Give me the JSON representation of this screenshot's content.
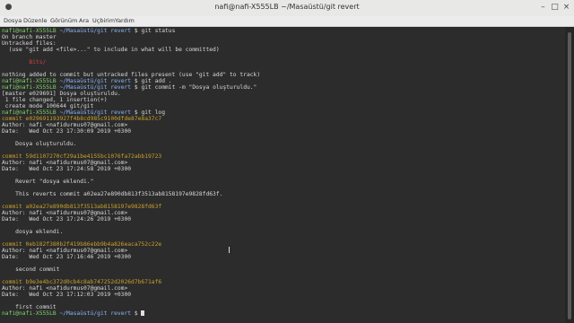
{
  "window": {
    "title": "nafi@nafi-X555LB ~/Masaüstü/git revert"
  },
  "menu": [
    "Dosya",
    "Düzenle",
    "Görünüm",
    "Ara",
    "Uçbirim",
    "Yardım"
  ],
  "prompt": {
    "user": "nafi@nafi-X555LB",
    "path": "~/Masaüstü/git revert",
    "symbol": "$"
  },
  "lines": [
    {
      "t": "prompt",
      "cmd": "git status"
    },
    {
      "t": "text",
      "s": "On branch master"
    },
    {
      "t": "text",
      "s": "Untracked files:"
    },
    {
      "t": "text",
      "s": "  (use \"git add <file>...\" to include in what will be committed)"
    },
    {
      "t": "blank"
    },
    {
      "t": "red",
      "s": "        Bits/"
    },
    {
      "t": "blank"
    },
    {
      "t": "text",
      "s": "nothing added to commit but untracked files present (use \"git add\" to track)"
    },
    {
      "t": "prompt",
      "cmd": "git add ."
    },
    {
      "t": "prompt",
      "cmd": "git commit -m \"Dosya oluşturuldu.\""
    },
    {
      "t": "text",
      "s": "[master e029691] Dosya oluşturuldu."
    },
    {
      "t": "text",
      "s": " 1 file changed, 1 insertion(+)"
    },
    {
      "t": "text",
      "s": " create mode 100644 git/git"
    },
    {
      "t": "prompt",
      "cmd": "git log"
    },
    {
      "t": "commit",
      "s": "commit e029691193927f4b8cd985c9100dfde87e8a37c7"
    },
    {
      "t": "text",
      "s": "Author: nafi <nafidurmus07@gmail.com>"
    },
    {
      "t": "text",
      "s": "Date:   Wed Oct 23 17:30:09 2019 +0300"
    },
    {
      "t": "blank"
    },
    {
      "t": "text",
      "s": "    Dosya oluşturuldu."
    },
    {
      "t": "blank"
    },
    {
      "t": "commit",
      "s": "commit 59d1107270cf29a1be4155bc1076fa72abb19723"
    },
    {
      "t": "text",
      "s": "Author: nafi <nafidurmus07@gmail.com>"
    },
    {
      "t": "text",
      "s": "Date:   Wed Oct 23 17:24:58 2019 +0300"
    },
    {
      "t": "blank"
    },
    {
      "t": "text",
      "s": "    Revert \"dosya eklendi.\""
    },
    {
      "t": "blank"
    },
    {
      "t": "text",
      "s": "    This reverts commit a02ea27e890db813f3513ab8158197e9828fd63f."
    },
    {
      "t": "blank"
    },
    {
      "t": "commit",
      "s": "commit a02ea27e890db813f3513ab8158197e9828fd63f"
    },
    {
      "t": "text",
      "s": "Author: nafi <nafidurmus07@gmail.com>"
    },
    {
      "t": "text",
      "s": "Date:   Wed Oct 23 17:24:26 2019 +0300"
    },
    {
      "t": "blank"
    },
    {
      "t": "text",
      "s": "    dosya eklendi."
    },
    {
      "t": "blank"
    },
    {
      "t": "commit",
      "s": "commit 0eb182f380b2f419b86ebb9b4a826eaca752c22e"
    },
    {
      "t": "text",
      "s": "Author: nafi <nafidurmus07@gmail.com>"
    },
    {
      "t": "text",
      "s": "Date:   Wed Oct 23 17:16:46 2019 +0300"
    },
    {
      "t": "blank"
    },
    {
      "t": "text",
      "s": "    second commit"
    },
    {
      "t": "blank"
    },
    {
      "t": "commit",
      "s": "commit b9e3e4bc372d0cb4c8ab747252d2026d7b671af6"
    },
    {
      "t": "text",
      "s": "Author: nafi <nafidurmus07@gmail.com>"
    },
    {
      "t": "text",
      "s": "Date:   Wed Oct 23 17:12:03 2019 +0300"
    },
    {
      "t": "blank"
    },
    {
      "t": "text",
      "s": "    first commit"
    },
    {
      "t": "prompt",
      "cmd": "",
      "cursor": true
    }
  ]
}
